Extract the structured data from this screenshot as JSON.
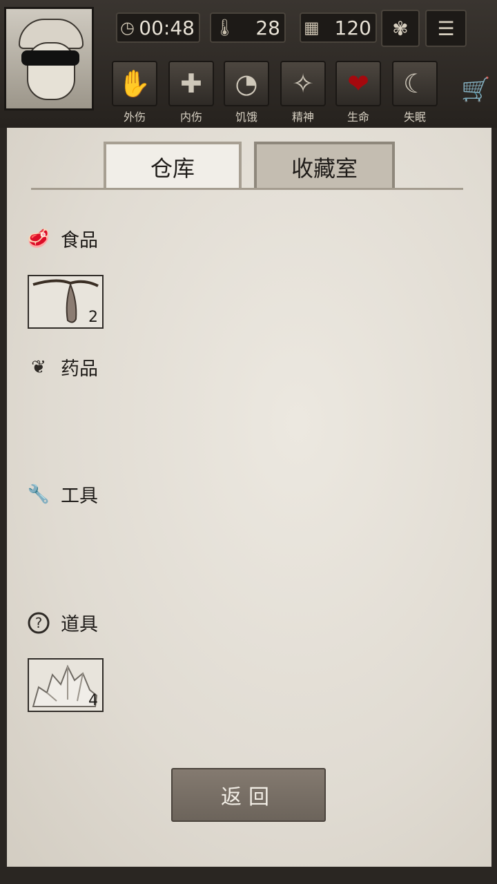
{
  "hud": {
    "time": "00:48",
    "temperature": "28",
    "days": "120",
    "icons": {
      "clock": "clock-icon",
      "thermometer": "thermometer-icon",
      "calendar": "calendar-icon",
      "sun": "sunflower-icon",
      "menu": "menu-icon"
    }
  },
  "status": [
    {
      "label": "外伤",
      "icon": "hand-bandage-icon"
    },
    {
      "label": "内伤",
      "icon": "cross-icon"
    },
    {
      "label": "饥饿",
      "icon": "stomach-icon"
    },
    {
      "label": "精神",
      "icon": "mind-icon"
    },
    {
      "label": "生命",
      "icon": "heart-icon"
    },
    {
      "label": "失眠",
      "icon": "moon-star-icon"
    }
  ],
  "tabs": {
    "warehouse": "仓库",
    "collection": "收藏室"
  },
  "sections": {
    "food": {
      "label": "食品",
      "items": [
        {
          "icon": "seed-pod-icon",
          "count": "2"
        }
      ]
    },
    "medicine": {
      "label": "药品"
    },
    "tools": {
      "label": "工具"
    },
    "props": {
      "label": "道具",
      "items": [
        {
          "icon": "crystal-icon",
          "count": "4"
        }
      ]
    }
  },
  "return_label": "返回"
}
